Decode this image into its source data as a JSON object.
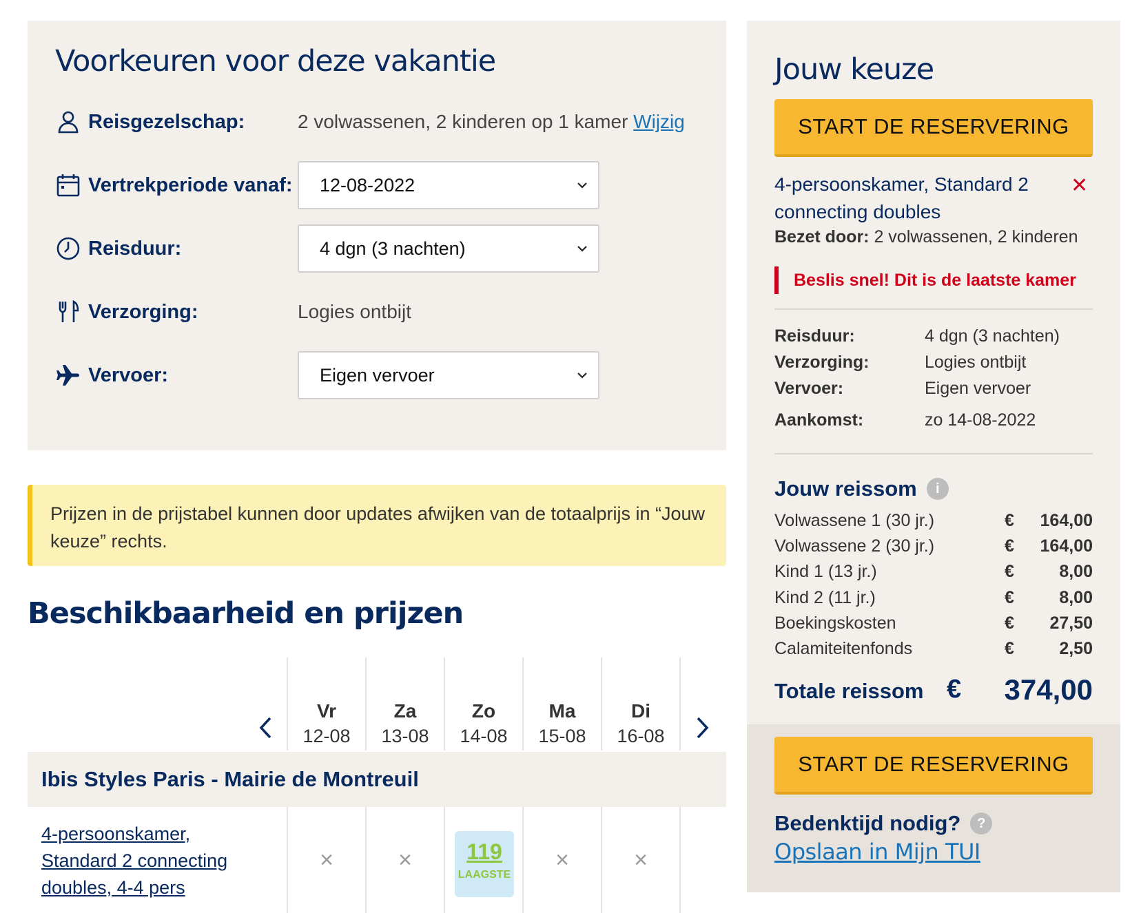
{
  "preferences": {
    "title": "Voorkeuren voor deze vakantie",
    "party_label": "Reisgezelschap:",
    "party_value": "2 volwassenen, 2 kinderen op 1 kamer",
    "party_change": "Wijzig",
    "departure_label": "Vertrekperiode vanaf:",
    "departure_value": "12-08-2022",
    "duration_label": "Reisduur:",
    "duration_value": "4 dgn (3 nachten)",
    "board_label": "Verzorging:",
    "board_value": "Logies ontbijt",
    "transport_label": "Vervoer:",
    "transport_value": "Eigen vervoer"
  },
  "notice": {
    "text": "Prijzen in de prijstabel kunnen door updates afwijken van de totaalprijs in “Jouw keuze” rechts."
  },
  "availability": {
    "title": "Beschikbaarheid en prijzen",
    "days": [
      {
        "name": "Vr",
        "date": "12-08"
      },
      {
        "name": "Za",
        "date": "13-08"
      },
      {
        "name": "Zo",
        "date": "14-08"
      },
      {
        "name": "Ma",
        "date": "15-08"
      },
      {
        "name": "Di",
        "date": "16-08"
      }
    ],
    "hotel_name": "Ibis Styles Paris - Mairie de Montreuil",
    "room_name": "4-persoonskamer, Standard 2 connecting doubles, 4-4 pers",
    "unavailable_mark": "×",
    "best_price": "119",
    "best_price_label": "LAAGSTE"
  },
  "choice": {
    "title": "Jouw keuze",
    "start_button": "START DE RESERVERING",
    "room_title": "4-persoonskamer, Standard 2 connecting doubles",
    "remove_icon": "✕",
    "occupied_label": "Bezet door:",
    "occupied_value": "2 volwassenen, 2 kinderen",
    "urgent": "Beslis snel! Dit is de laatste kamer",
    "summary": [
      {
        "label": "Reisduur:",
        "value": "4 dgn (3 nachten)"
      },
      {
        "label": "Verzorging:",
        "value": "Logies ontbijt"
      },
      {
        "label": "Vervoer:",
        "value": "Eigen vervoer"
      },
      {
        "label": "Aankomst:",
        "value": "zo 14-08-2022"
      }
    ],
    "reissom_title": "Jouw reissom",
    "info_icon": "i",
    "currency": "€",
    "prices": [
      {
        "label": "Volwassene 1 (30 jr.)",
        "amount": "164,00"
      },
      {
        "label": "Volwassene 2 (30 jr.)",
        "amount": "164,00"
      },
      {
        "label": "Kind 1 (13 jr.)",
        "amount": "8,00"
      },
      {
        "label": "Kind 2 (11 jr.)",
        "amount": "8,00"
      },
      {
        "label": "Boekingskosten",
        "amount": "27,50"
      },
      {
        "label": "Calamiteitenfonds",
        "amount": "2,50"
      }
    ],
    "total_label": "Totale reissom",
    "total_amount": "374,00",
    "think_label": "Bedenktijd nodig?",
    "help_icon": "?",
    "save_link": "Opslaan in Mijn TUI"
  },
  "colors": {
    "brand_navy": "#092a5e",
    "cta_yellow": "#f7b731",
    "alert_red": "#d0021b",
    "link_blue": "#1a73b6",
    "best_price_green": "#8dc63f"
  }
}
